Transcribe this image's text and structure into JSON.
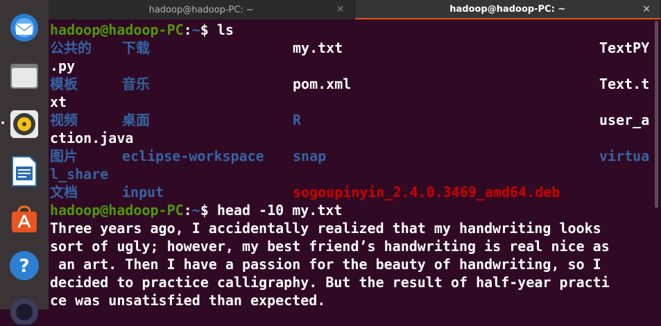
{
  "dock": {
    "items": [
      {
        "name": "thunderbird-icon"
      },
      {
        "name": "files-icon"
      },
      {
        "name": "rhythmbox-icon"
      },
      {
        "name": "libreoffice-writer-icon"
      },
      {
        "name": "ubuntu-software-icon"
      },
      {
        "name": "help-icon"
      },
      {
        "name": "app-icon"
      }
    ]
  },
  "tabs": [
    {
      "title": "hadoop@hadoop-PC: ~",
      "close": "×"
    },
    {
      "title": "hadoop@hadoop-PC: ~",
      "close": "×"
    }
  ],
  "terminal": {
    "prompt_user": "hadoop@hadoop-PC",
    "prompt_sep": ":",
    "prompt_path": "~",
    "prompt_sym": "$ ",
    "cmd1": "ls",
    "ls": {
      "r1": [
        "公共的",
        "下载",
        "my.txt",
        "TextPY"
      ],
      "r1_wrap": ".py",
      "r2": [
        "模板",
        "音乐",
        "pom.xml",
        "Text.t"
      ],
      "r2_wrap": "xt",
      "r3": [
        "视频",
        "桌面",
        "R",
        "user_a"
      ],
      "r3_wrap": "ction.java",
      "r4": [
        "图片",
        "eclipse-workspace",
        "snap",
        "virtua"
      ],
      "r4_wrap": "l_share",
      "r5": [
        "文档",
        "input",
        "sogoupinyin_2.4.0.3469_amd64.deb"
      ]
    },
    "cmd2": "head -10 my.txt",
    "output": [
      "Three years ago, I accidentally realized that my handwriting looks",
      "sort of ugly; however, my best friend’s handwriting is real nice as",
      " an art. Then I have a passion for the beauty of handwriting, so I",
      "decided to practice calligraphy. But the result of half-year practi",
      "ce was unsatisfied than expected."
    ]
  }
}
